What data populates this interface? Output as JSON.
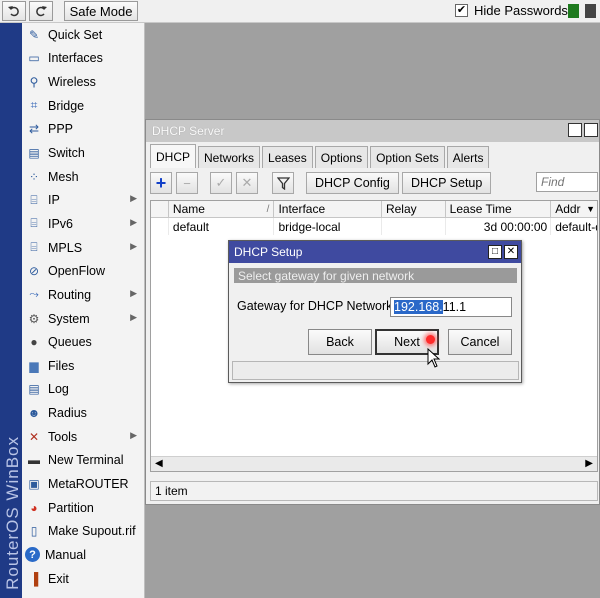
{
  "toolbar": {
    "safe_mode_label": "Safe Mode",
    "hide_passwords_label": "Hide Passwords",
    "hide_passwords_checked": true
  },
  "brand": "RouterOS WinBox",
  "sidebar": {
    "items": [
      {
        "label": "Quick Set",
        "icon": "wand-icon",
        "submenu": false
      },
      {
        "label": "Interfaces",
        "icon": "interface-card-icon",
        "submenu": false
      },
      {
        "label": "Wireless",
        "icon": "antenna-icon",
        "submenu": false
      },
      {
        "label": "Bridge",
        "icon": "bridge-icon",
        "submenu": false
      },
      {
        "label": "PPP",
        "icon": "ppp-icon",
        "submenu": false
      },
      {
        "label": "Switch",
        "icon": "switch-icon",
        "submenu": false
      },
      {
        "label": "Mesh",
        "icon": "mesh-icon",
        "submenu": false
      },
      {
        "label": "IP",
        "icon": "ip-icon",
        "submenu": true
      },
      {
        "label": "IPv6",
        "icon": "ipv6-icon",
        "submenu": true
      },
      {
        "label": "MPLS",
        "icon": "mpls-icon",
        "submenu": true
      },
      {
        "label": "OpenFlow",
        "icon": "openflow-icon",
        "submenu": false
      },
      {
        "label": "Routing",
        "icon": "routing-icon",
        "submenu": true
      },
      {
        "label": "System",
        "icon": "gear-icon",
        "submenu": true
      },
      {
        "label": "Queues",
        "icon": "queues-icon",
        "submenu": false
      },
      {
        "label": "Files",
        "icon": "folder-icon",
        "submenu": false
      },
      {
        "label": "Log",
        "icon": "log-icon",
        "submenu": false
      },
      {
        "label": "Radius",
        "icon": "radius-icon",
        "submenu": false
      },
      {
        "label": "Tools",
        "icon": "tools-icon",
        "submenu": true
      },
      {
        "label": "New Terminal",
        "icon": "terminal-icon",
        "submenu": false
      },
      {
        "label": "MetaROUTER",
        "icon": "metarouter-icon",
        "submenu": false
      },
      {
        "label": "Partition",
        "icon": "partition-icon",
        "submenu": false
      },
      {
        "label": "Make Supout.rif",
        "icon": "document-icon",
        "submenu": false
      },
      {
        "label": "Manual",
        "icon": "help-icon",
        "submenu": false
      },
      {
        "label": "Exit",
        "icon": "exit-icon",
        "submenu": false
      }
    ]
  },
  "dhcp_window": {
    "title": "DHCP Server",
    "tabs": [
      "DHCP",
      "Networks",
      "Leases",
      "Options",
      "Option Sets",
      "Alerts"
    ],
    "active_tab": "DHCP",
    "buttons": {
      "dhcp_config": "DHCP Config",
      "dhcp_setup": "DHCP Setup"
    },
    "find_placeholder": "Find",
    "columns": [
      "Name",
      "Interface",
      "Relay",
      "Lease Time",
      "Addr"
    ],
    "rows": [
      {
        "name": "default",
        "interface": "bridge-local",
        "relay": "",
        "lease_time": "3d 00:00:00",
        "addr": "default-d"
      }
    ],
    "status": "1 item"
  },
  "setup_dialog": {
    "title": "DHCP Setup",
    "subtitle": "Select gateway for given network",
    "gateway_label": "Gateway for DHCP Network:",
    "gateway_selected": "192.168.",
    "gateway_rest": "11.1",
    "buttons": {
      "back": "Back",
      "next": "Next",
      "cancel": "Cancel"
    }
  }
}
